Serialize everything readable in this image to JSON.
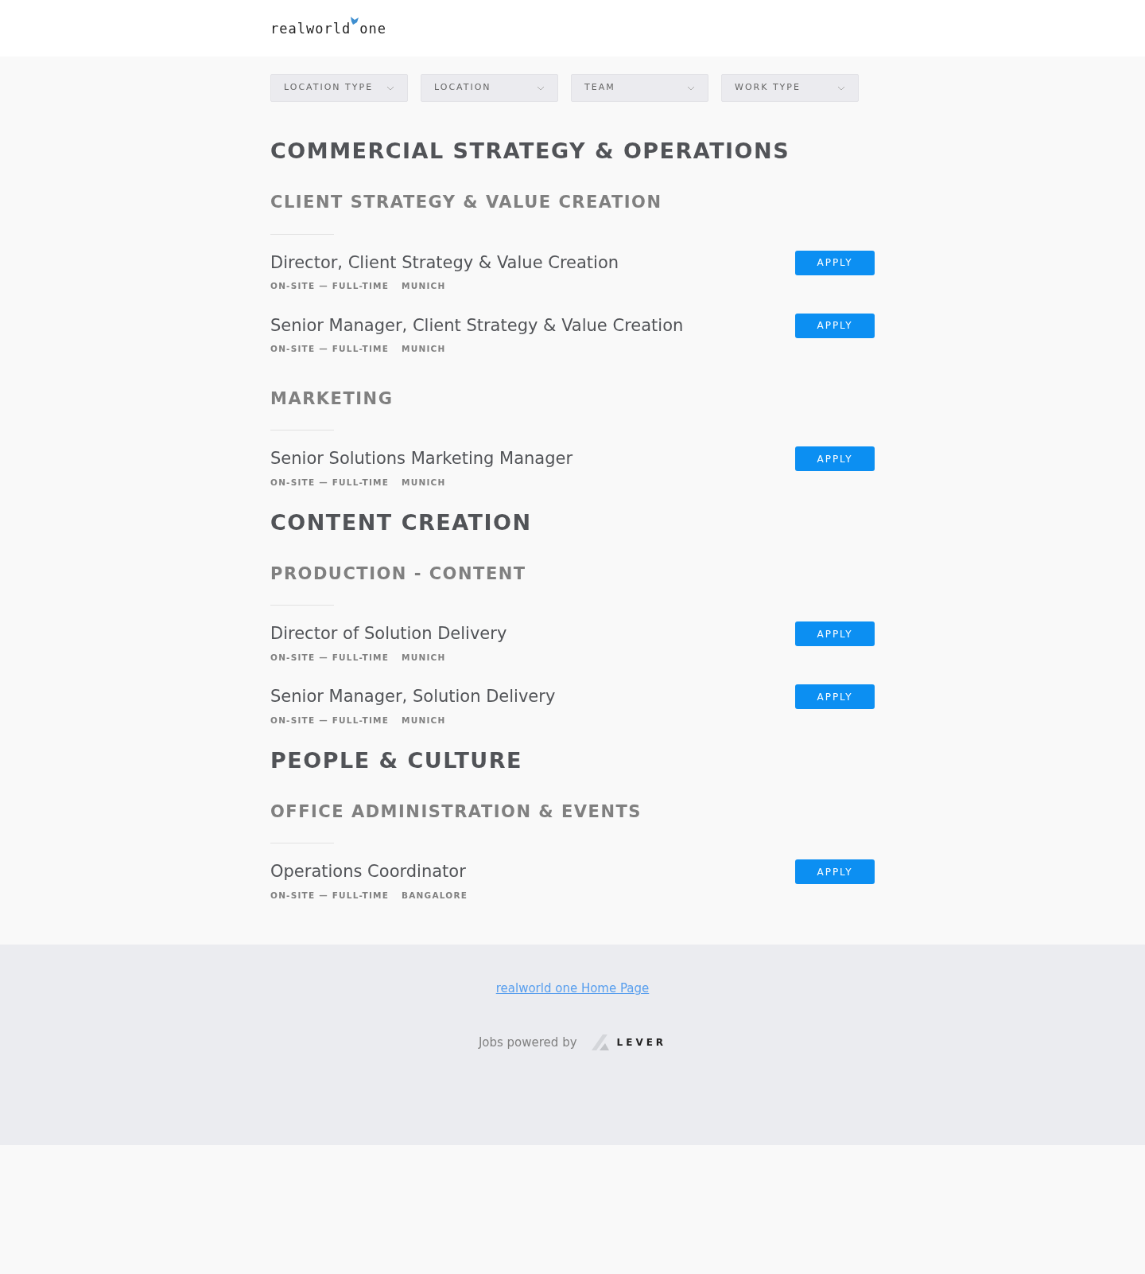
{
  "header": {
    "logo": "realworld one"
  },
  "filters": [
    {
      "label": "LOCATION TYPE"
    },
    {
      "label": "LOCATION"
    },
    {
      "label": "TEAM"
    },
    {
      "label": "WORK TYPE"
    }
  ],
  "departments": [
    {
      "title": "COMMERCIAL STRATEGY & OPERATIONS",
      "teams": [
        {
          "title": "CLIENT STRATEGY & VALUE CREATION",
          "postings": [
            {
              "title": "Director, Client Strategy & Value Creation",
              "commitment": "ON-SITE — FULL-TIME",
              "location": "MUNICH",
              "button": "APPLY"
            },
            {
              "title": "Senior Manager, Client Strategy & Value Creation",
              "commitment": "ON-SITE — FULL-TIME",
              "location": "MUNICH",
              "button": "APPLY"
            }
          ]
        },
        {
          "title": "MARKETING",
          "postings": [
            {
              "title": "Senior Solutions Marketing Manager",
              "commitment": "ON-SITE — FULL-TIME",
              "location": "MUNICH",
              "button": "APPLY"
            }
          ]
        }
      ]
    },
    {
      "title": "CONTENT CREATION",
      "teams": [
        {
          "title": "PRODUCTION - CONTENT",
          "postings": [
            {
              "title": "Director of Solution Delivery",
              "commitment": "ON-SITE — FULL-TIME",
              "location": "MUNICH",
              "button": "APPLY"
            },
            {
              "title": "Senior Manager, Solution Delivery",
              "commitment": "ON-SITE — FULL-TIME",
              "location": "MUNICH",
              "button": "APPLY"
            }
          ]
        }
      ]
    },
    {
      "title": "PEOPLE & CULTURE",
      "teams": [
        {
          "title": "OFFICE ADMINISTRATION & EVENTS",
          "postings": [
            {
              "title": "Operations Coordinator",
              "commitment": "ON-SITE — FULL-TIME",
              "location": "BANGALORE",
              "button": "APPLY"
            }
          ]
        }
      ]
    }
  ],
  "footer": {
    "home_link": "realworld one Home Page",
    "powered_by": "Jobs powered by",
    "brand": "LEVER"
  }
}
